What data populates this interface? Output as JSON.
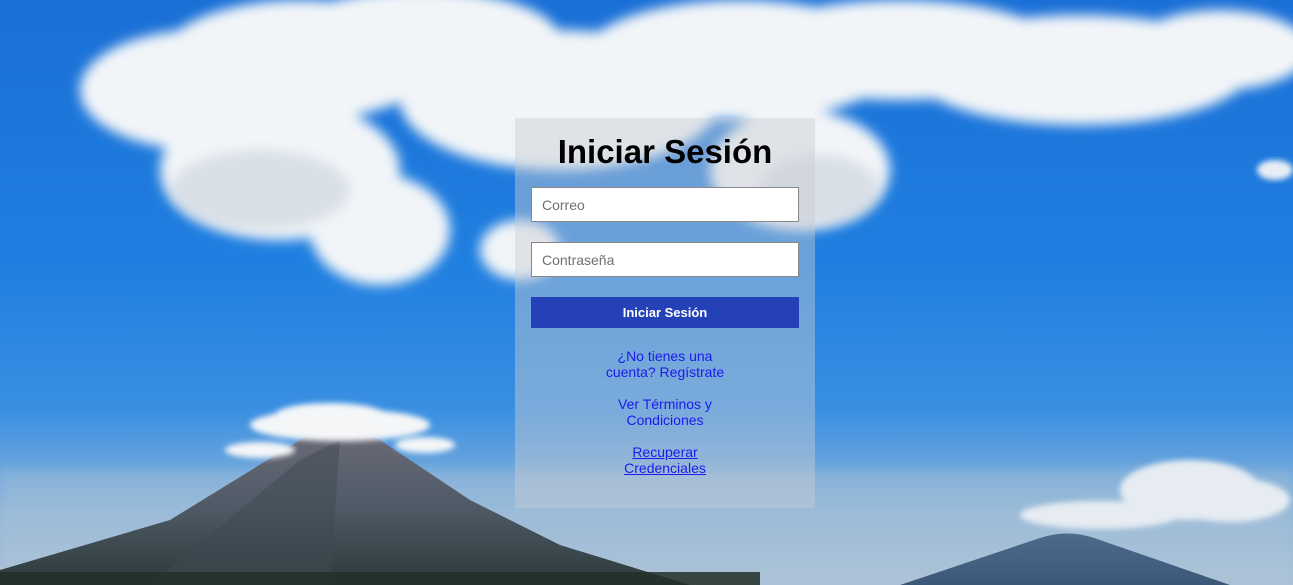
{
  "login": {
    "title": "Iniciar Sesión",
    "email_placeholder": "Correo",
    "email_value": "",
    "password_placeholder": "Contraseña",
    "password_value": "",
    "submit_label": "Iniciar Sesión",
    "register_link": "¿No tienes una cuenta? Regístrate",
    "terms_link": "Ver Términos y Condiciones",
    "recover_link": "Recuperar Credenciales"
  },
  "colors": {
    "sky": "#1f7fe0",
    "button": "#2441b8",
    "link": "#1a1aee"
  }
}
